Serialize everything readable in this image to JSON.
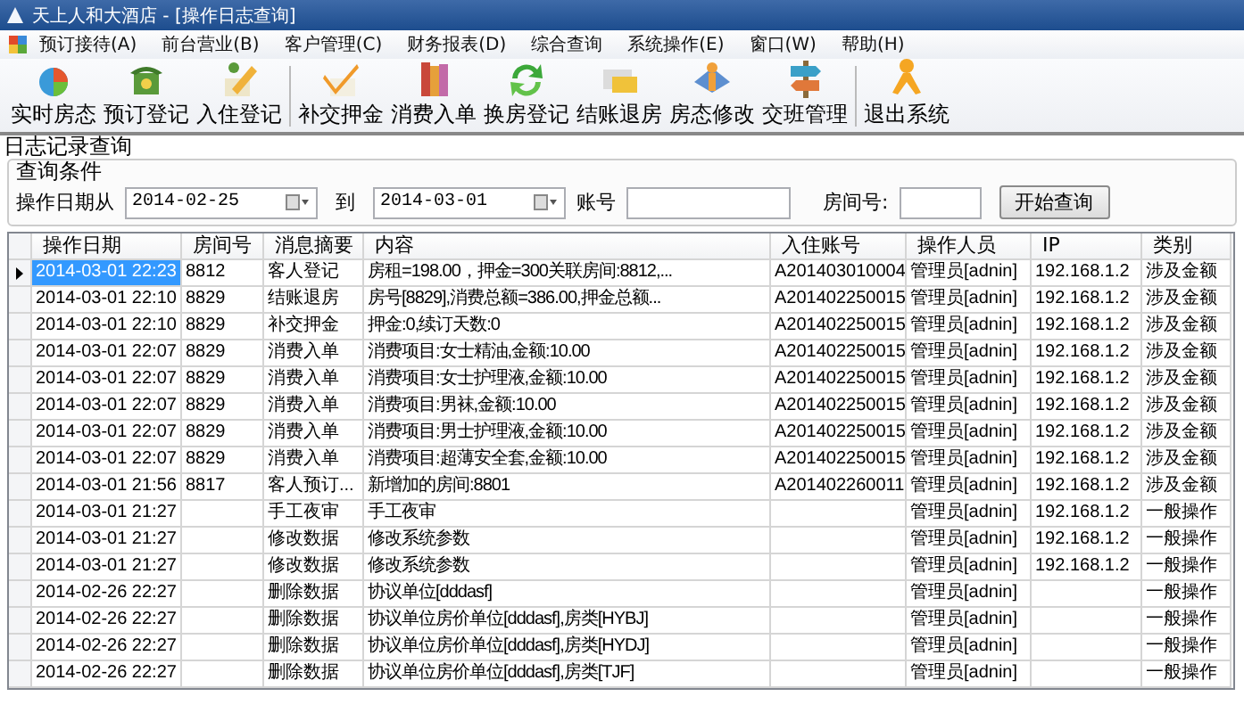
{
  "window": {
    "title": "天上人和大酒店 - [操作日志查询]"
  },
  "menu": [
    "预订接待(A)",
    "前台营业(B)",
    "客户管理(C)",
    "财务报表(D)",
    "综合查询",
    "系统操作(E)",
    "窗口(W)",
    "帮助(H)"
  ],
  "toolbar": [
    {
      "label": "实时房态",
      "group_start": false
    },
    {
      "label": "预订登记",
      "group_start": false
    },
    {
      "label": "入住登记",
      "group_start": false
    },
    {
      "label": "补交押金",
      "group_start": true
    },
    {
      "label": "消费入单",
      "group_start": false
    },
    {
      "label": "换房登记",
      "group_start": false
    },
    {
      "label": "结账退房",
      "group_start": false
    },
    {
      "label": "房态修改",
      "group_start": false
    },
    {
      "label": "交班管理",
      "group_start": false
    },
    {
      "label": "退出系统",
      "group_start": true
    }
  ],
  "panel_title": "日志记录查询",
  "filter": {
    "title": "查询条件",
    "date_from_label": "操作日期从",
    "date_from": "2014-02-25",
    "date_to_label": "到",
    "date_to": "2014-03-01",
    "account_label": "账号",
    "room_label": "房间号:",
    "search_button": "开始查询"
  },
  "table": {
    "columns": [
      "操作日期",
      "房间号",
      "消息摘要",
      "内容",
      "入住账号",
      "操作人员",
      "IP",
      "类别"
    ],
    "rows": [
      {
        "selected": true,
        "cells": [
          "2014-03-01 22:23",
          "8812",
          "客人登记",
          "房租=198.00，押金=300关联房间:8812,...",
          "A201403010004",
          "管理员[adnin]",
          "192.168.1.2",
          "涉及金额"
        ]
      },
      {
        "selected": false,
        "cells": [
          "2014-03-01 22:10",
          "8829",
          "结账退房",
          "房号[8829],消费总额=386.00,押金总额...",
          "A201402250015",
          "管理员[adnin]",
          "192.168.1.2",
          "涉及金额"
        ]
      },
      {
        "selected": false,
        "cells": [
          "2014-03-01 22:10",
          "8829",
          "补交押金",
          "押金:0,续订天数:0",
          "A201402250015",
          "管理员[adnin]",
          "192.168.1.2",
          "涉及金额"
        ]
      },
      {
        "selected": false,
        "cells": [
          "2014-03-01 22:07",
          "8829",
          "消费入单",
          "消费项目:女士精油,金额:10.00",
          "A201402250015",
          "管理员[adnin]",
          "192.168.1.2",
          "涉及金额"
        ]
      },
      {
        "selected": false,
        "cells": [
          "2014-03-01 22:07",
          "8829",
          "消费入单",
          "消费项目:女士护理液,金额:10.00",
          "A201402250015",
          "管理员[adnin]",
          "192.168.1.2",
          "涉及金额"
        ]
      },
      {
        "selected": false,
        "cells": [
          "2014-03-01 22:07",
          "8829",
          "消费入单",
          "消费项目:男袜,金额:10.00",
          "A201402250015",
          "管理员[adnin]",
          "192.168.1.2",
          "涉及金额"
        ]
      },
      {
        "selected": false,
        "cells": [
          "2014-03-01 22:07",
          "8829",
          "消费入单",
          "消费项目:男士护理液,金额:10.00",
          "A201402250015",
          "管理员[adnin]",
          "192.168.1.2",
          "涉及金额"
        ]
      },
      {
        "selected": false,
        "cells": [
          "2014-03-01 22:07",
          "8829",
          "消费入单",
          "消费项目:超薄安全套,金额:10.00",
          "A201402250015",
          "管理员[adnin]",
          "192.168.1.2",
          "涉及金额"
        ]
      },
      {
        "selected": false,
        "cells": [
          "2014-03-01 21:56",
          "8817",
          "客人预订...",
          "新增加的房间:8801",
          "A201402260011",
          "管理员[adnin]",
          "192.168.1.2",
          "涉及金额"
        ]
      },
      {
        "selected": false,
        "cells": [
          "2014-03-01 21:27",
          "",
          "手工夜审",
          "手工夜审",
          "",
          "管理员[adnin]",
          "192.168.1.2",
          "一般操作"
        ]
      },
      {
        "selected": false,
        "cells": [
          "2014-03-01 21:27",
          "",
          "修改数据",
          "修改系统参数",
          "",
          "管理员[adnin]",
          "192.168.1.2",
          "一般操作"
        ]
      },
      {
        "selected": false,
        "cells": [
          "2014-03-01 21:27",
          "",
          "修改数据",
          "修改系统参数",
          "",
          "管理员[adnin]",
          "192.168.1.2",
          "一般操作"
        ]
      },
      {
        "selected": false,
        "cells": [
          "2014-02-26 22:27",
          "",
          "删除数据",
          "协议单位[dddasf]",
          "",
          "管理员[adnin]",
          "",
          "一般操作"
        ]
      },
      {
        "selected": false,
        "cells": [
          "2014-02-26 22:27",
          "",
          "删除数据",
          "协议单位房价单位[dddasf],房类[HYBJ]",
          "",
          "管理员[adnin]",
          "",
          "一般操作"
        ]
      },
      {
        "selected": false,
        "cells": [
          "2014-02-26 22:27",
          "",
          "删除数据",
          "协议单位房价单位[dddasf],房类[HYDJ]",
          "",
          "管理员[adnin]",
          "",
          "一般操作"
        ]
      },
      {
        "selected": false,
        "cells": [
          "2014-02-26 22:27",
          "",
          "删除数据",
          "协议单位房价单位[dddasf],房类[TJF]",
          "",
          "管理员[adnin]",
          "",
          "一般操作"
        ]
      }
    ]
  }
}
